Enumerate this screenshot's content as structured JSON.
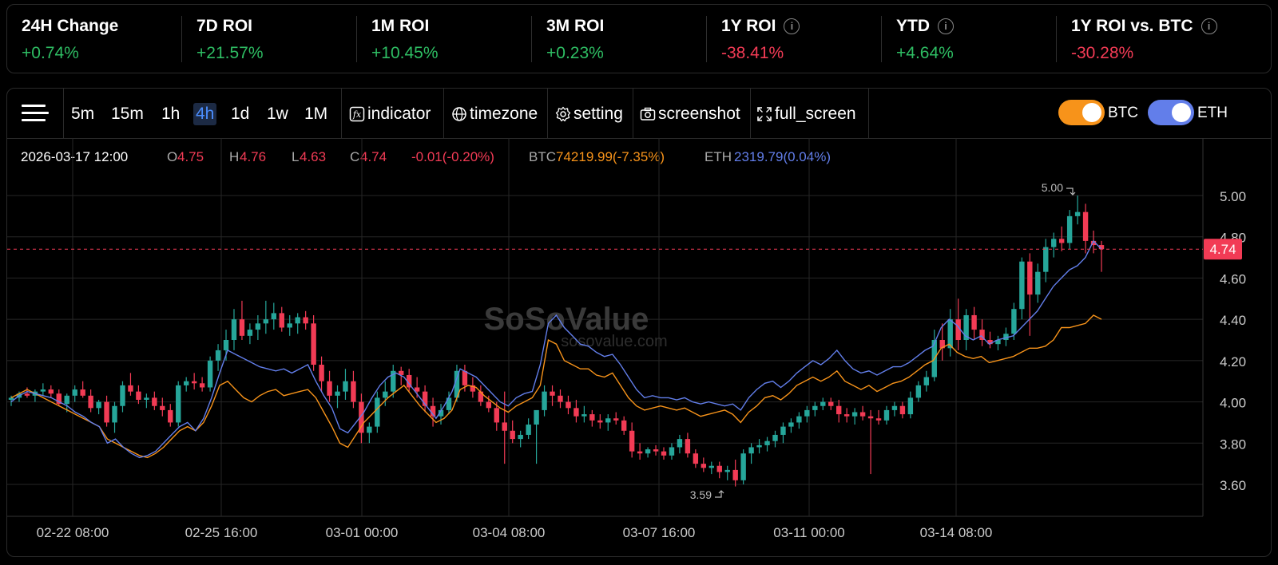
{
  "stats": [
    {
      "label": "24H Change",
      "value": "+0.74%",
      "positive": true,
      "info": false
    },
    {
      "label": "7D ROI",
      "value": "+21.57%",
      "positive": true,
      "info": false
    },
    {
      "label": "1M ROI",
      "value": "+10.45%",
      "positive": true,
      "info": false
    },
    {
      "label": "3M ROI",
      "value": "+0.23%",
      "positive": true,
      "info": false
    },
    {
      "label": "1Y ROI",
      "value": "-38.41%",
      "positive": false,
      "info": true
    },
    {
      "label": "YTD",
      "value": "+4.64%",
      "positive": true,
      "info": true
    },
    {
      "label": "1Y ROI vs. BTC",
      "value": "-30.28%",
      "positive": false,
      "info": true
    }
  ],
  "toolbar": {
    "intervals": [
      "5m",
      "15m",
      "1h",
      "4h",
      "1d",
      "1w",
      "1M"
    ],
    "active_interval": "4h",
    "indicator": "indicator",
    "timezone": "timezone",
    "setting": "setting",
    "screenshot": "screenshot",
    "full_screen": "full_screen"
  },
  "toggles": [
    {
      "label": "BTC",
      "on": true,
      "color": "#f7931a"
    },
    {
      "label": "ETH",
      "on": true,
      "color": "#627eea"
    }
  ],
  "legend": {
    "datetime": "2026-03-17 12:00",
    "o_label": "O",
    "o": "4.75",
    "h_label": "H",
    "h": "4.76",
    "l_label": "L",
    "l": "4.63",
    "c_label": "C",
    "c": "4.74",
    "change": "-0.01(-0.20%)",
    "btc_label": "BTC",
    "btc": "74219.99(-7.35%)",
    "eth_label": "ETH",
    "eth": "2319.79(0.04%)"
  },
  "watermark": {
    "name": "SoSoValue",
    "url": "sosovalue.com"
  },
  "chart_data": {
    "type": "candlestick",
    "y_ticks": [
      "5.00",
      "4.80",
      "4.60",
      "4.40",
      "4.20",
      "4.00",
      "3.80",
      "3.60"
    ],
    "ylim": [
      3.52,
      5.08
    ],
    "x_labels": [
      "02-22 08:00",
      "02-25 16:00",
      "03-01 00:00",
      "03-04 08:00",
      "03-07 16:00",
      "03-11 00:00",
      "03-14 08:00"
    ],
    "current_price": "4.74",
    "high_marker": "5.00",
    "low_marker": "3.59",
    "up_color": "#26a69a",
    "down_color": "#f23b55",
    "candles": [
      [
        4.01,
        4.03,
        3.98,
        4.02
      ],
      [
        4.02,
        4.05,
        4.0,
        4.04
      ],
      [
        4.04,
        4.07,
        4.02,
        4.03
      ],
      [
        4.03,
        4.06,
        4.0,
        4.05
      ],
      [
        4.05,
        4.09,
        4.03,
        4.06
      ],
      [
        4.06,
        4.08,
        4.02,
        4.04
      ],
      [
        4.04,
        4.06,
        3.98,
        3.99
      ],
      [
        3.99,
        4.04,
        3.95,
        4.03
      ],
      [
        4.03,
        4.08,
        4.0,
        4.06
      ],
      [
        4.06,
        4.1,
        4.02,
        4.03
      ],
      [
        4.03,
        4.06,
        3.95,
        3.97
      ],
      [
        3.97,
        4.01,
        3.94,
        4.0
      ],
      [
        4.0,
        4.03,
        3.88,
        3.9
      ],
      [
        3.9,
        4.0,
        3.85,
        3.98
      ],
      [
        3.98,
        4.1,
        3.95,
        4.08
      ],
      [
        4.08,
        4.14,
        4.03,
        4.05
      ],
      [
        4.05,
        4.08,
        3.99,
        4.01
      ],
      [
        4.01,
        4.04,
        3.97,
        4.02
      ],
      [
        4.02,
        4.05,
        3.96,
        3.98
      ],
      [
        3.98,
        4.02,
        3.93,
        3.96
      ],
      [
        3.96,
        3.99,
        3.88,
        3.9
      ],
      [
        3.9,
        4.1,
        3.88,
        4.08
      ],
      [
        4.08,
        4.12,
        4.05,
        4.1
      ],
      [
        4.1,
        4.14,
        4.06,
        4.09
      ],
      [
        4.09,
        4.12,
        4.05,
        4.07
      ],
      [
        4.07,
        4.22,
        4.05,
        4.2
      ],
      [
        4.2,
        4.28,
        4.15,
        4.25
      ],
      [
        4.25,
        4.35,
        4.2,
        4.3
      ],
      [
        4.3,
        4.45,
        4.25,
        4.4
      ],
      [
        4.4,
        4.49,
        4.3,
        4.32
      ],
      [
        4.32,
        4.38,
        4.28,
        4.35
      ],
      [
        4.35,
        4.42,
        4.3,
        4.38
      ],
      [
        4.38,
        4.49,
        4.33,
        4.4
      ],
      [
        4.4,
        4.48,
        4.35,
        4.43
      ],
      [
        4.43,
        4.46,
        4.34,
        4.36
      ],
      [
        4.36,
        4.42,
        4.32,
        4.38
      ],
      [
        4.38,
        4.43,
        4.33,
        4.41
      ],
      [
        4.41,
        4.44,
        4.35,
        4.38
      ],
      [
        4.38,
        4.42,
        4.15,
        4.18
      ],
      [
        4.18,
        4.22,
        4.05,
        4.1
      ],
      [
        4.1,
        4.15,
        4.0,
        4.03
      ],
      [
        4.03,
        4.08,
        3.97,
        4.05
      ],
      [
        4.05,
        4.16,
        4.01,
        4.1
      ],
      [
        4.1,
        4.15,
        3.97,
        4.0
      ],
      [
        4.0,
        4.04,
        3.8,
        3.85
      ],
      [
        3.85,
        3.9,
        3.8,
        3.88
      ],
      [
        3.88,
        4.05,
        3.85,
        4.02
      ],
      [
        4.02,
        4.1,
        3.98,
        4.05
      ],
      [
        4.05,
        4.18,
        4.02,
        4.15
      ],
      [
        4.15,
        4.17,
        4.08,
        4.13
      ],
      [
        4.13,
        4.16,
        4.05,
        4.07
      ],
      [
        4.07,
        4.12,
        4.02,
        4.05
      ],
      [
        4.05,
        4.08,
        3.95,
        3.98
      ],
      [
        3.98,
        4.02,
        3.88,
        3.93
      ],
      [
        3.93,
        3.99,
        3.89,
        3.96
      ],
      [
        3.96,
        4.05,
        3.94,
        4.02
      ],
      [
        4.02,
        4.18,
        4.0,
        4.15
      ],
      [
        4.15,
        4.18,
        4.05,
        4.08
      ],
      [
        4.08,
        4.12,
        4.02,
        4.05
      ],
      [
        4.05,
        4.08,
        3.98,
        4.0
      ],
      [
        4.0,
        4.03,
        3.95,
        3.97
      ],
      [
        3.97,
        4.0,
        3.86,
        3.9
      ],
      [
        3.9,
        4.05,
        3.7,
        3.86
      ],
      [
        3.86,
        3.91,
        3.8,
        3.82
      ],
      [
        3.82,
        3.86,
        3.78,
        3.84
      ],
      [
        3.84,
        3.92,
        3.82,
        3.89
      ],
      [
        3.89,
        3.95,
        3.7,
        3.96
      ],
      [
        3.96,
        4.08,
        3.93,
        4.05
      ],
      [
        4.05,
        4.08,
        3.98,
        4.03
      ],
      [
        4.03,
        4.06,
        3.97,
        4.0
      ],
      [
        4.0,
        4.03,
        3.94,
        3.97
      ],
      [
        3.97,
        4.01,
        3.9,
        3.93
      ],
      [
        3.93,
        3.98,
        3.9,
        3.94
      ],
      [
        3.94,
        3.96,
        3.88,
        3.91
      ],
      [
        3.91,
        3.94,
        3.87,
        3.9
      ],
      [
        3.9,
        3.94,
        3.86,
        3.92
      ],
      [
        3.92,
        3.95,
        3.89,
        3.91
      ],
      [
        3.91,
        3.93,
        3.84,
        3.86
      ],
      [
        3.86,
        3.9,
        3.73,
        3.76
      ],
      [
        3.76,
        3.8,
        3.72,
        3.75
      ],
      [
        3.75,
        3.78,
        3.73,
        3.77
      ],
      [
        3.77,
        3.79,
        3.74,
        3.76
      ],
      [
        3.76,
        3.78,
        3.72,
        3.74
      ],
      [
        3.74,
        3.8,
        3.72,
        3.78
      ],
      [
        3.78,
        3.84,
        3.75,
        3.82
      ],
      [
        3.82,
        3.85,
        3.73,
        3.75
      ],
      [
        3.75,
        3.77,
        3.68,
        3.7
      ],
      [
        3.7,
        3.73,
        3.66,
        3.68
      ],
      [
        3.68,
        3.71,
        3.65,
        3.69
      ],
      [
        3.69,
        3.71,
        3.63,
        3.66
      ],
      [
        3.66,
        3.69,
        3.62,
        3.67
      ],
      [
        3.67,
        3.72,
        3.59,
        3.62
      ],
      [
        3.62,
        3.77,
        3.6,
        3.75
      ],
      [
        3.75,
        3.8,
        3.7,
        3.78
      ],
      [
        3.78,
        3.82,
        3.75,
        3.79
      ],
      [
        3.79,
        3.83,
        3.76,
        3.81
      ],
      [
        3.81,
        3.86,
        3.78,
        3.84
      ],
      [
        3.84,
        3.9,
        3.8,
        3.88
      ],
      [
        3.88,
        3.92,
        3.85,
        3.9
      ],
      [
        3.9,
        3.95,
        3.87,
        3.93
      ],
      [
        3.93,
        3.98,
        3.9,
        3.96
      ],
      [
        3.96,
        4.0,
        3.93,
        3.98
      ],
      [
        3.98,
        4.02,
        3.96,
        4.0
      ],
      [
        4.0,
        4.02,
        3.96,
        3.98
      ],
      [
        3.98,
        4.01,
        3.9,
        3.94
      ],
      [
        3.94,
        3.97,
        3.9,
        3.93
      ],
      [
        3.93,
        3.97,
        3.89,
        3.95
      ],
      [
        3.95,
        3.98,
        3.91,
        3.93
      ],
      [
        3.93,
        3.96,
        3.65,
        3.92
      ],
      [
        3.92,
        3.96,
        3.89,
        3.91
      ],
      [
        3.91,
        3.98,
        3.89,
        3.96
      ],
      [
        3.96,
        4.0,
        3.93,
        3.98
      ],
      [
        3.98,
        4.0,
        3.92,
        3.94
      ],
      [
        3.94,
        4.05,
        3.92,
        4.02
      ],
      [
        4.02,
        4.1,
        4.0,
        4.08
      ],
      [
        4.08,
        4.15,
        4.05,
        4.12
      ],
      [
        4.12,
        4.35,
        4.1,
        4.3
      ],
      [
        4.3,
        4.38,
        4.2,
        4.26
      ],
      [
        4.26,
        4.45,
        4.22,
        4.4
      ],
      [
        4.4,
        4.5,
        4.25,
        4.3
      ],
      [
        4.3,
        4.45,
        4.25,
        4.42
      ],
      [
        4.42,
        4.46,
        4.3,
        4.35
      ],
      [
        4.35,
        4.4,
        4.27,
        4.3
      ],
      [
        4.3,
        4.34,
        4.26,
        4.28
      ],
      [
        4.28,
        4.32,
        4.25,
        4.3
      ],
      [
        4.3,
        4.36,
        4.27,
        4.33
      ],
      [
        4.33,
        4.48,
        4.3,
        4.45
      ],
      [
        4.45,
        4.7,
        4.4,
        4.68
      ],
      [
        4.68,
        4.72,
        4.32,
        4.52
      ],
      [
        4.52,
        4.67,
        4.48,
        4.63
      ],
      [
        4.63,
        4.79,
        4.58,
        4.75
      ],
      [
        4.75,
        4.82,
        4.7,
        4.79
      ],
      [
        4.79,
        4.85,
        4.73,
        4.77
      ],
      [
        4.77,
        4.93,
        4.74,
        4.9
      ],
      [
        4.9,
        5.0,
        4.86,
        4.92
      ],
      [
        4.92,
        4.96,
        4.72,
        4.78
      ],
      [
        4.78,
        4.83,
        4.72,
        4.76
      ],
      [
        4.76,
        4.78,
        4.63,
        4.74
      ]
    ],
    "series": [
      {
        "name": "BTC",
        "color": "#f7931a",
        "values": [
          4.02,
          4.04,
          4.06,
          4.04,
          4.02,
          4.0,
          3.98,
          3.96,
          3.94,
          3.92,
          3.9,
          3.88,
          3.82,
          3.8,
          3.78,
          3.76,
          3.74,
          3.73,
          3.75,
          3.78,
          3.82,
          3.86,
          3.88,
          3.86,
          3.9,
          3.98,
          4.08,
          4.1,
          4.06,
          4.02,
          4.0,
          4.03,
          4.05,
          4.06,
          4.03,
          4.04,
          4.05,
          4.06,
          4.02,
          3.95,
          3.88,
          3.8,
          3.78,
          3.84,
          3.9,
          3.94,
          3.98,
          4.02,
          4.05,
          4.08,
          4.03,
          3.98,
          3.94,
          3.9,
          3.92,
          3.96,
          4.06,
          4.08,
          4.07,
          4.03,
          4.0,
          3.97,
          3.95,
          3.98,
          4.0,
          4.02,
          4.08,
          4.3,
          4.28,
          4.2,
          4.18,
          4.16,
          4.16,
          4.13,
          4.12,
          4.14,
          4.08,
          4.02,
          3.98,
          3.96,
          3.97,
          3.98,
          3.97,
          3.96,
          3.97,
          3.95,
          3.93,
          3.94,
          3.95,
          3.96,
          3.94,
          3.9,
          3.95,
          3.98,
          4.02,
          4.03,
          4.01,
          4.04,
          4.08,
          4.1,
          4.12,
          4.1,
          4.12,
          4.15,
          4.1,
          4.08,
          4.06,
          4.08,
          4.05,
          4.07,
          4.09,
          4.1,
          4.12,
          4.15,
          4.18,
          4.2,
          4.26,
          4.28,
          4.24,
          4.22,
          4.21,
          4.22,
          4.19,
          4.2,
          4.21,
          4.22,
          4.24,
          4.26,
          4.26,
          4.27,
          4.3,
          4.36,
          4.36,
          4.37,
          4.38,
          4.42,
          4.4
        ]
      },
      {
        "name": "ETH",
        "color": "#627eea",
        "values": [
          4.0,
          4.03,
          4.05,
          4.04,
          4.03,
          4.02,
          4.0,
          3.98,
          3.95,
          3.93,
          3.9,
          3.88,
          3.8,
          3.82,
          3.78,
          3.75,
          3.73,
          3.74,
          3.76,
          3.8,
          3.84,
          3.88,
          3.9,
          3.86,
          3.92,
          4.02,
          4.14,
          4.25,
          4.23,
          4.21,
          4.19,
          4.17,
          4.16,
          4.15,
          4.16,
          4.14,
          4.16,
          4.18,
          4.1,
          4.03,
          3.97,
          3.87,
          3.85,
          3.9,
          3.95,
          4.02,
          4.08,
          4.12,
          4.14,
          4.12,
          4.07,
          4.02,
          3.97,
          3.92,
          3.98,
          4.05,
          4.16,
          4.14,
          4.12,
          4.08,
          4.04,
          4.0,
          3.98,
          4.02,
          4.04,
          4.05,
          4.18,
          4.38,
          4.42,
          4.36,
          4.32,
          4.28,
          4.27,
          4.24,
          4.22,
          4.23,
          4.18,
          4.12,
          4.06,
          4.02,
          4.03,
          4.02,
          4.02,
          4.01,
          4.02,
          4.0,
          3.99,
          4.0,
          3.99,
          3.98,
          3.99,
          3.96,
          4.02,
          4.06,
          4.09,
          4.1,
          4.07,
          4.1,
          4.14,
          4.17,
          4.2,
          4.18,
          4.21,
          4.25,
          4.2,
          4.16,
          4.14,
          4.15,
          4.13,
          4.15,
          4.17,
          4.17,
          4.19,
          4.22,
          4.25,
          4.27,
          4.36,
          4.4,
          4.37,
          4.32,
          4.3,
          4.32,
          4.28,
          4.3,
          4.31,
          4.32,
          4.36,
          4.4,
          4.44,
          4.5,
          4.56,
          4.6,
          4.64,
          4.66,
          4.7,
          4.78,
          4.74
        ]
      }
    ]
  }
}
